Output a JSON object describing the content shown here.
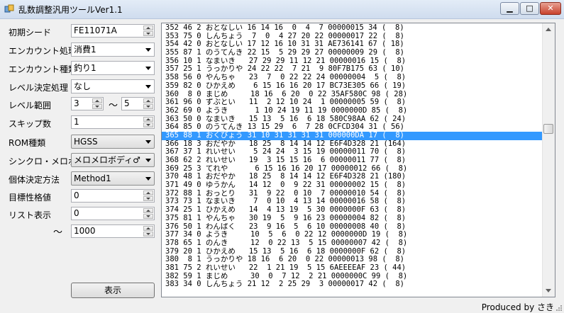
{
  "window": {
    "title": "乱数調整汎用ツールVer1.1"
  },
  "form": {
    "initial_seed": {
      "label": "初期シード",
      "value": "FE11071A"
    },
    "encounter_process": {
      "label": "エンカウント処理",
      "value": "消費1"
    },
    "encounter_type": {
      "label": "エンカウント種類",
      "value": "釣り1"
    },
    "level_process": {
      "label": "レベル決定処理",
      "value": "なし"
    },
    "level_range": {
      "label": "レベル範囲",
      "min": "3",
      "tilde": "～",
      "max": "5"
    },
    "skip_count": {
      "label": "スキップ数",
      "value": "1"
    },
    "rom_type": {
      "label": "ROM種類",
      "value": "HGSS"
    },
    "synchro": {
      "label": "シンクロ・メロボ",
      "value": "メロメロボディ♂"
    },
    "individual_method": {
      "label": "個体決定方法",
      "value": "Method1"
    },
    "target_personality": {
      "label": "目標性格値",
      "value": "0"
    },
    "list_display": {
      "label": "リスト表示",
      "from": "0",
      "tilde": "～",
      "to": "1000"
    },
    "show_button": {
      "label": "表示"
    }
  },
  "list": {
    "selected_index": 13,
    "rows": [
      "352 46 2 おとなしい 16 14 16  0  4  7 00000015 34 (  8)",
      "353 75 0 しんちょう  7  0  4 27 20 22 00000017 22 (  8)",
      "354 42 0 おとなしい 17 12 16 10 31 31 AE736141 67 ( 18)",
      "355 87 1 のうてんき 22 15  5 29 29 27 00000009 29 (  8)",
      "356 10 1 なまいき   27 29 29 11 12 21 00000016 15 (  8)",
      "357 25 1 うっかりや 24 22 22  7 21  9 80F7B175 63 ( 10)",
      "358 56 0 やんちゃ   23  7  0 22 22 24 00000004  5 (  8)",
      "359 82 0 ひかえめ    6 15 16 16 20 17 BC73E305 66 ( 19)",
      "360  8 0 まじめ     18 16  6 20  0 22 35AF580C 98 ( 28)",
      "361 96 0 ずぶとい   11  2 12 10 24  1 00000005 59 (  8)",
      "362 69 0 ようき      1 10 24 19 11 19 0000000D 85 (  8)",
      "363 50 0 なまいき   15 13  5 16  6 18 580C98AA 62 ( 24)",
      "364 85 0 のうてんき 13 15 29  6  7 28 0CFCD304 31 ( 56)",
      "365 88 1 おくびょう 31 10 31 31 31 31 000000DA 17 (  8)",
      "366 18 3 おだやか   18 25  8 14 14 12 E6F4D328 21 (164)",
      "367 37 1 れいせい    5 24 24  3 15 19 00000011 70 (  8)",
      "368 62 2 れいせい   19  3 15 15 16  6 00000011 77 (  8)",
      "369 25 3 てれや      6 15 16 16 20 17 00000012 66 (  8)",
      "370 48 1 おだやか   18 25  8 14 14 12 E6F4D328 21 (180)",
      "371 49 0 ゆうかん   14 12  0  9 22 31 00000002 15 (  8)",
      "372 88 1 おっとり   31  9 22  0 10  7 00000010 54 (  8)",
      "373 73 1 なまいき    7  0 10  4 13 14 00000016 58 (  8)",
      "374 25 1 ひかえめ   14  4 13 19  5 30 0000000F 63 (  8)",
      "375 81 1 やんちゃ   30 19  5  9 16 23 00000004 82 (  8)",
      "376 50 1 わんぱく   23  9 16  5  6 10 00000008 40 (  8)",
      "377 34 0 ようき     10  5  6  0 22 12 0000000D 19 (  8)",
      "378 65 1 のんき     12  0 22 13  5 15 00000007 42 (  8)",
      "379 20 1 ひかえめ   15 13  5 16  6 18 0000000F 62 (  8)",
      "380  8 1 うっかりや 18 16  6 20  0 22 00000013 98 (  8)",
      "381 75 2 れいせい   22  1 21 19  5 15 6AEEEEAF 23 ( 44)",
      "382 59 1 まじめ     30  0  7 12  2 21 0000000C 99 (  8)",
      "383 34 0 しんちょう 21 12  2 25 29  3 00000017 42 (  8)"
    ]
  },
  "status": {
    "text": "Produced by さき"
  },
  "icons": {
    "app": "app-icon",
    "minimize": "minimize-icon",
    "maximize": "maximize-icon",
    "close": "close-icon"
  }
}
